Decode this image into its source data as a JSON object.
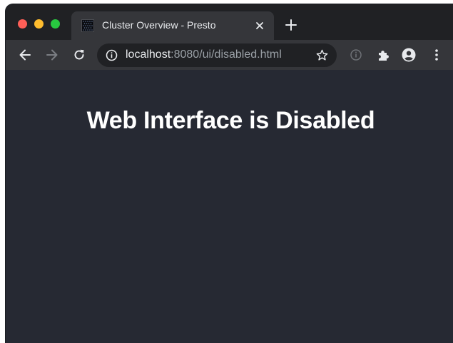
{
  "browser": {
    "tab": {
      "title": "Cluster Overview - Presto",
      "favicon": "presto-logo-icon"
    },
    "new_tab_icon": "plus-icon",
    "toolbar": {
      "back_icon": "back-arrow-icon",
      "forward_icon": "forward-arrow-icon",
      "reload_icon": "reload-icon",
      "extensions_icon": "puzzle-icon",
      "account_icon": "account-circle-icon",
      "menu_icon": "kebab-menu-icon"
    },
    "address_bar": {
      "host": "localhost",
      "path": ":8080/ui/disabled.html",
      "info_icon": "info-icon",
      "bookmark_icon": "star-icon"
    }
  },
  "page": {
    "heading": "Web Interface is Disabled",
    "background_color": "#262933"
  }
}
